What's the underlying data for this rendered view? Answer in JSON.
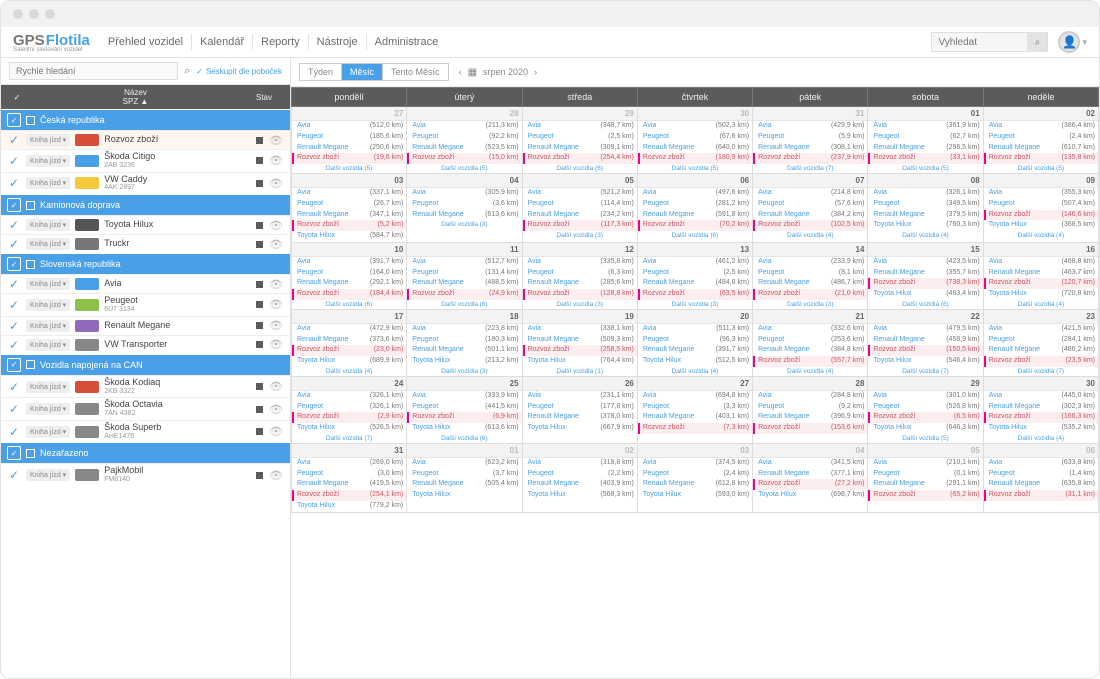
{
  "brand": {
    "gps": "GPS",
    "flotila": "Flotila",
    "subtitle": "Satelitní sledování vozidel"
  },
  "nav": [
    "Přehled vozidel",
    "Kalendář",
    "Reporty",
    "Nástroje",
    "Administrace"
  ],
  "search": {
    "placeholder": "Vyhledat"
  },
  "sidebar": {
    "quicksearch_placeholder": "Rychlé hledání",
    "group_by_branches": "Seskupit dle poboček",
    "head": {
      "name": "Název",
      "spz": "SPZ ▲",
      "status": "Stav"
    },
    "knihajizd": "Kniha jízd ▾",
    "groups": [
      {
        "name": "Česká republika",
        "vehicles": [
          {
            "name": "Rozvoz zboží",
            "plate": "",
            "color": "#d84d3a",
            "selected": true
          },
          {
            "name": "Škoda Citigo",
            "plate": "2AB 3236",
            "color": "#4aa0e6"
          },
          {
            "name": "VW Caddy",
            "plate": "4AK 2897",
            "color": "#f5c93b"
          }
        ]
      },
      {
        "name": "Kamionová doprava",
        "vehicles": [
          {
            "name": "Toyota Hilux",
            "plate": "",
            "color": "#555"
          },
          {
            "name": "Truckr",
            "plate": "",
            "color": "#777"
          }
        ]
      },
      {
        "name": "Slovenská republika",
        "vehicles": [
          {
            "name": "Avia",
            "plate": "",
            "color": "#4aa0e6"
          },
          {
            "name": "Peugeot",
            "plate": "6U7 3134",
            "color": "#8bc34a"
          },
          {
            "name": "Renault Megane",
            "plate": "",
            "color": "#8e6ab8"
          },
          {
            "name": "VW Transporter",
            "plate": "",
            "color": "#888"
          }
        ]
      },
      {
        "name": "Vozidla napojená na CAN",
        "vehicles": [
          {
            "name": "Škoda Kodiaq",
            "plate": "2KB 3322",
            "color": "#d84d3a"
          },
          {
            "name": "Škoda Octavia",
            "plate": "7AN 4382",
            "color": "#888"
          },
          {
            "name": "Škoda Superb",
            "plate": "AHE1476",
            "color": "#888"
          }
        ]
      },
      {
        "name": "Nezařazeno",
        "vehicles": [
          {
            "name": "PajkMobil",
            "plate": "FM8140",
            "color": "#888"
          }
        ]
      }
    ]
  },
  "calendar": {
    "view_tabs": [
      "Týden",
      "Měsíc",
      "Tento Měsíc"
    ],
    "active_tab": 1,
    "period": "srpen 2020",
    "weekday_labels": [
      "pondělí",
      "úterý",
      "středa",
      "čtvrtek",
      "pátek",
      "sobota",
      "neděle"
    ],
    "rozvoz_label": "Rozvoz zboží",
    "more_label_prefix": "Další vozidla",
    "weeks": [
      [
        {
          "day": 27,
          "out": true,
          "entries": [
            [
              "Avia",
              "512,0 km"
            ],
            [
              "Peugeot",
              "185,6 km"
            ],
            [
              "Renault Megane",
              "250,6 km"
            ]
          ],
          "rozvoz": "19,6 km",
          "more": 5
        },
        {
          "day": 28,
          "out": true,
          "entries": [
            [
              "Avia",
              "211,3 km"
            ],
            [
              "Peugeot",
              "92,2 km"
            ],
            [
              "Renault Megane",
              "523,5 km"
            ]
          ],
          "rozvoz": "15,0 km",
          "more": 5
        },
        {
          "day": 29,
          "out": true,
          "entries": [
            [
              "Avia",
              "348,7 km"
            ],
            [
              "Peugeot",
              "2,5 km"
            ],
            [
              "Renault Megane",
              "309,1 km"
            ]
          ],
          "rozvoz": "254,4 km",
          "more": 6
        },
        {
          "day": 30,
          "out": true,
          "entries": [
            [
              "Avia",
              "502,3 km"
            ],
            [
              "Peugeot",
              "67,6 km"
            ],
            [
              "Renault Megane",
              "640,0 km"
            ]
          ],
          "rozvoz": "180,9 km",
          "more": 5
        },
        {
          "day": 31,
          "out": true,
          "entries": [
            [
              "Avia",
              "429,9 km"
            ],
            [
              "Peugeot",
              "5,9 km"
            ],
            [
              "Renault Megane",
              "308,1 km"
            ]
          ],
          "rozvoz": "237,9 km",
          "more": 7
        },
        {
          "day": "01",
          "entries": [
            [
              "Avia",
              "361,9 km"
            ],
            [
              "Peugeot",
              "62,7 km"
            ],
            [
              "Renault Megane",
              "296,5 km"
            ]
          ],
          "rozvoz": "33,1 km",
          "more": 5
        },
        {
          "day": "02",
          "entries": [
            [
              "Avia",
              "386,4 km"
            ],
            [
              "Peugeot",
              "2,4 km"
            ],
            [
              "Renault Megane",
              "610,7 km"
            ]
          ],
          "rozvoz": "135,8 km",
          "more": 5
        }
      ],
      [
        {
          "day": "03",
          "entries": [
            [
              "Avia",
              "337,1 km"
            ],
            [
              "Peugeot",
              "26,7 km"
            ],
            [
              "Renault Megane",
              "347,1 km"
            ]
          ],
          "rozvoz": "5,2 km",
          "extra": [
            "Toyota Hilux",
            "584,7 km"
          ]
        },
        {
          "day": "04",
          "entries": [
            [
              "Avia",
              "305,9 km"
            ],
            [
              "Peugeot",
              "3,6 km"
            ],
            [
              "Renault Megane",
              "613,6 km"
            ]
          ],
          "rozvoz": "",
          "more": 3
        },
        {
          "day": "05",
          "entries": [
            [
              "Avia",
              "521,2 km"
            ],
            [
              "Peugeot",
              "114,4 km"
            ],
            [
              "Renault Megane",
              "234,2 km"
            ]
          ],
          "rozvoz": "117,3 km",
          "more": 3
        },
        {
          "day": "06",
          "entries": [
            [
              "Avia",
              "497,6 km"
            ],
            [
              "Peugeot",
              "281,2 km"
            ],
            [
              "Renault Megane",
              "591,8 km"
            ]
          ],
          "rozvoz": "70,2 km",
          "more": 6
        },
        {
          "day": "07",
          "entries": [
            [
              "Avia",
              "214,8 km"
            ],
            [
              "Peugeot",
              "57,6 km"
            ],
            [
              "Renault Megane",
              "384,2 km"
            ]
          ],
          "rozvoz": "102,5 km",
          "more": 4
        },
        {
          "day": "08",
          "entries": [
            [
              "Avia",
              "326,1 km"
            ],
            [
              "Peugeot",
              "349,5 km"
            ],
            [
              "Renault Megane",
              "379,5 km"
            ]
          ],
          "extra": [
            "Toyota Hilux",
            "760,3 km"
          ],
          "more": 4
        },
        {
          "day": "09",
          "entries": [
            [
              "Avia",
              "355,3 km"
            ],
            [
              "Peugeot",
              "507,4 km"
            ]
          ],
          "rozvoz": "146,6 km",
          "extra": [
            "Toyota Hilux",
            "368,5 km"
          ],
          "more": 4
        }
      ],
      [
        {
          "day": 10,
          "entries": [
            [
              "Avia",
              "391,7 km"
            ],
            [
              "Peugeot",
              "164,0 km"
            ],
            [
              "Renault Megane",
              "292,1 km"
            ]
          ],
          "rozvoz": "184,4 km",
          "more": 6
        },
        {
          "day": 11,
          "entries": [
            [
              "Avia",
              "512,7 km"
            ],
            [
              "Peugeot",
              "131,4 km"
            ],
            [
              "Renault Megane",
              "488,5 km"
            ]
          ],
          "rozvoz": "24,9 km",
          "more": 6
        },
        {
          "day": 12,
          "entries": [
            [
              "Avia",
              "335,8 km"
            ],
            [
              "Peugeot",
              "6,3 km"
            ],
            [
              "Renault Megane",
              "285,6 km"
            ]
          ],
          "rozvoz": "128,8 km",
          "more": 3
        },
        {
          "day": 13,
          "entries": [
            [
              "Avia",
              "461,2 km"
            ],
            [
              "Peugeot",
              "2,5 km"
            ],
            [
              "Renault Megane",
              "484,8 km"
            ]
          ],
          "rozvoz": "63,5 km",
          "more": 3
        },
        {
          "day": 14,
          "entries": [
            [
              "Avia",
              "233,9 km"
            ],
            [
              "Peugeot",
              "8,1 km"
            ],
            [
              "Renault Megane",
              "486,7 km"
            ]
          ],
          "rozvoz": "21,0 km",
          "more": 3
        },
        {
          "day": 15,
          "entries": [
            [
              "Avia",
              "423,5 km"
            ],
            [
              "Renault Megane",
              "355,7 km"
            ]
          ],
          "rozvoz": "738,3 km",
          "extra": [
            "Toyota Hilux",
            "463,4 km"
          ],
          "more": 6
        },
        {
          "day": 16,
          "entries": [
            [
              "Avia",
              "468,8 km"
            ],
            [
              "Renault Megane",
              "463,7 km"
            ]
          ],
          "rozvoz": "120,7 km",
          "extra": [
            "Toyota Hilux",
            "720,8 km"
          ],
          "more": 4
        }
      ],
      [
        {
          "day": 17,
          "entries": [
            [
              "Avia",
              "472,9 km"
            ],
            [
              "Renault Megane",
              "373,6 km"
            ]
          ],
          "rozvoz": "23,0 km",
          "extra": [
            "Toyota Hilux",
            "689,9 km"
          ],
          "more": 4
        },
        {
          "day": 18,
          "entries": [
            [
              "Avia",
              "223,8 km"
            ],
            [
              "Peugeot",
              "180,3 km"
            ],
            [
              "Renault Megane",
              "501,1 km"
            ]
          ],
          "rozvoz": "",
          "extra": [
            "Toyota Hilux",
            "213,2 km"
          ],
          "more": 3
        },
        {
          "day": 19,
          "entries": [
            [
              "Avia",
              "338,1 km"
            ],
            [
              "Renault Megane",
              "509,3 km"
            ]
          ],
          "rozvoz": "258,5 km",
          "extra": [
            "Toyota Hilux",
            "764,4 km"
          ],
          "more": 1
        },
        {
          "day": 20,
          "entries": [
            [
              "Avia",
              "511,3 km"
            ],
            [
              "Peugeot",
              "96,3 km"
            ],
            [
              "Renault Megane",
              "391,7 km"
            ]
          ],
          "extra": [
            "Toyota Hilux",
            "512,5 km"
          ],
          "more": 4
        },
        {
          "day": 21,
          "entries": [
            [
              "Avia",
              "332,6 km"
            ],
            [
              "Peugeot",
              "253,6 km"
            ],
            [
              "Renault Megane",
              "384,8 km"
            ]
          ],
          "rozvoz": "557,7 km",
          "more": 4
        },
        {
          "day": 22,
          "entries": [
            [
              "Avia",
              "479,5 km"
            ],
            [
              "Renault Megane",
              "458,9 km"
            ]
          ],
          "rozvoz": "150,5 km",
          "extra": [
            "Toyota Hilux",
            "546,4 km"
          ],
          "more": 7
        },
        {
          "day": 23,
          "entries": [
            [
              "Avia",
              "421,5 km"
            ],
            [
              "Peugeot",
              "284,1 km"
            ],
            [
              "Renault Megane",
              "486,2 km"
            ]
          ],
          "rozvoz": "23,5 km",
          "more": 7
        }
      ],
      [
        {
          "day": 24,
          "entries": [
            [
              "Avia",
              "326,1 km"
            ],
            [
              "Peugeot",
              "326,1 km"
            ]
          ],
          "rozvoz": "2,9 km",
          "extra": [
            "Toyota Hilux",
            "526,5 km"
          ],
          "more": 7
        },
        {
          "day": 25,
          "entries": [
            [
              "Avia",
              "333,9 km"
            ],
            [
              "Peugeot",
              "441,5 km"
            ]
          ],
          "rozvoz": "6,9 km",
          "extra": [
            "Toyota Hilux",
            "613,6 km"
          ],
          "more": 6
        },
        {
          "day": 26,
          "entries": [
            [
              "Avia",
              "231,1 km"
            ],
            [
              "Peugeot",
              "177,8 km"
            ],
            [
              "Renault Megane",
              "378,0 km"
            ]
          ],
          "extra": [
            "Toyota Hilux",
            "667,9 km"
          ],
          "more": ""
        },
        {
          "day": 27,
          "entries": [
            [
              "Avia",
              "694,8 km"
            ],
            [
              "Peugeot",
              "3,3 km"
            ],
            [
              "Renault Megane",
              "403,1 km"
            ]
          ],
          "rozvoz": "7,3 km",
          "more": ""
        },
        {
          "day": 28,
          "entries": [
            [
              "Avia",
              "284,8 km"
            ],
            [
              "Peugeot",
              "9,2 km"
            ],
            [
              "Renault Megane",
              "396,9 km"
            ]
          ],
          "rozvoz": "153,6 km",
          "more": ""
        },
        {
          "day": 29,
          "entries": [
            [
              "Avia",
              "301,0 km"
            ],
            [
              "Peugeot",
              "526,8 km"
            ]
          ],
          "rozvoz": "6,5 km",
          "extra": [
            "Toyota Hilux",
            "646,3 km"
          ],
          "more": 5
        },
        {
          "day": 30,
          "entries": [
            [
              "Avia",
              "445,0 km"
            ],
            [
              "Renault Megane",
              "302,3 km"
            ]
          ],
          "rozvoz": "166,3 km",
          "extra": [
            "Toyota Hilux",
            "535,2 km"
          ],
          "more": 4
        }
      ],
      [
        {
          "day": 31,
          "entries": [
            [
              "Avia",
              "269,0 km"
            ],
            [
              "Peugeot",
              "3,0 km"
            ],
            [
              "Renault Megane",
              "419,5 km"
            ]
          ],
          "rozvoz": "254,1 km",
          "extra": [
            "Toyota Hilux",
            "779,2 km"
          ]
        },
        {
          "day": "01",
          "out": true,
          "entries": [
            [
              "Avia",
              "623,2 km"
            ],
            [
              "Peugeot",
              "3,7 km"
            ],
            [
              "Renault Megane",
              "505,4 km"
            ]
          ],
          "extra": [
            "Toyota Hilux",
            ""
          ]
        },
        {
          "day": "02",
          "out": true,
          "entries": [
            [
              "Avia",
              "318,8 km"
            ],
            [
              "Peugeot",
              "2,2 km"
            ],
            [
              "Renault Megane",
              "403,9 km"
            ]
          ],
          "extra": [
            "Toyota Hilux",
            "568,3 km"
          ]
        },
        {
          "day": "03",
          "out": true,
          "entries": [
            [
              "Avia",
              "374,5 km"
            ],
            [
              "Peugeot",
              "2,4 km"
            ],
            [
              "Renault Megane",
              "612,8 km"
            ]
          ],
          "extra": [
            "Toyota Hilux",
            "593,0 km"
          ]
        },
        {
          "day": "04",
          "out": true,
          "entries": [
            [
              "Avia",
              "341,5 km"
            ],
            [
              "Renault Megane",
              "377,1 km"
            ]
          ],
          "rozvoz": "27,2 km",
          "extra": [
            "Toyota Hilux",
            "698,7 km"
          ]
        },
        {
          "day": "05",
          "out": true,
          "entries": [
            [
              "Avia",
              "210,1 km"
            ],
            [
              "Peugeot",
              "0,1 km"
            ],
            [
              "Renault Megane",
              "291,1 km"
            ]
          ],
          "rozvoz": "65,2 km"
        },
        {
          "day": "06",
          "out": true,
          "entries": [
            [
              "Avia",
              "633,8 km"
            ],
            [
              "Peugeot",
              "1,4 km"
            ],
            [
              "Renault Megane",
              "635,8 km"
            ]
          ],
          "rozvoz": "31,1 km"
        }
      ]
    ]
  }
}
